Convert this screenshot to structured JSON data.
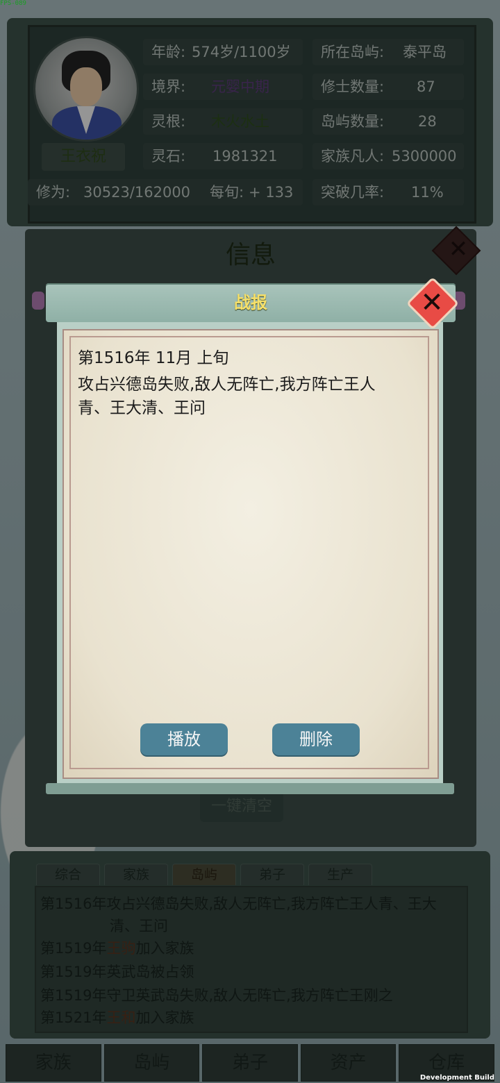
{
  "fps": "FPS-089",
  "dev_build": "Development Build",
  "status": {
    "name": "王衣祝",
    "age_label": "年龄:",
    "age_value": "574岁/1100岁",
    "island_label": "所在岛屿:",
    "island_value": "泰平岛",
    "realm_label": "境界:",
    "realm_value": "元婴中期",
    "cultivators_label": "修士数量:",
    "cultivators_value": "87",
    "root_label": "灵根:",
    "root_value": "木火水土",
    "islands_label": "岛屿数量:",
    "islands_value": "28",
    "stones_label": "灵石:",
    "stones_value": "1981321",
    "mortals_label": "家族凡人:",
    "mortals_value": "5300000",
    "cultivation_label": "修为:",
    "cultivation_value": "30523/162000",
    "per_turn_label": "每旬:",
    "per_turn_value": "+ 133",
    "breakthrough_label": "突破几率:",
    "breakthrough_value": "11%"
  },
  "info_panel": {
    "title": "信息",
    "clear_button": "一键清空"
  },
  "modal": {
    "title": "战报",
    "date_line": "第1516年 11月 上旬",
    "message_line1": "攻占兴德岛失败,敌人无阵亡,我方阵亡王人",
    "message_line2": "青、王大清、王问",
    "play_button": "播放",
    "delete_button": "删除"
  },
  "log_tabs": [
    "综合",
    "家族",
    "岛屿",
    "弟子",
    "生产"
  ],
  "log_entries": {
    "e1_year": "第1516年",
    "e1_text": "攻占兴德岛失败,敌人无阵亡,我方阵亡王人青、王大",
    "e1_cont": "清、王问",
    "e2_year": "第1519年",
    "e2_name": "王驹",
    "e2_text": "加入家族",
    "e3_year": "第1519年",
    "e3_text": "英武岛被占领",
    "e4_year": "第1519年",
    "e4_text": "守卫英武岛失败,敌人无阵亡,我方阵亡王刚之",
    "e5_year": "第1521年",
    "e5_name": "王和",
    "e5_text": "加入家族"
  },
  "bottom_nav": [
    "家族",
    "岛屿",
    "弟子",
    "资产",
    "仓库"
  ],
  "colors": {
    "modal_title": "#f6e06a",
    "action_button": "#4c8297",
    "close_button": "#e84b45"
  }
}
